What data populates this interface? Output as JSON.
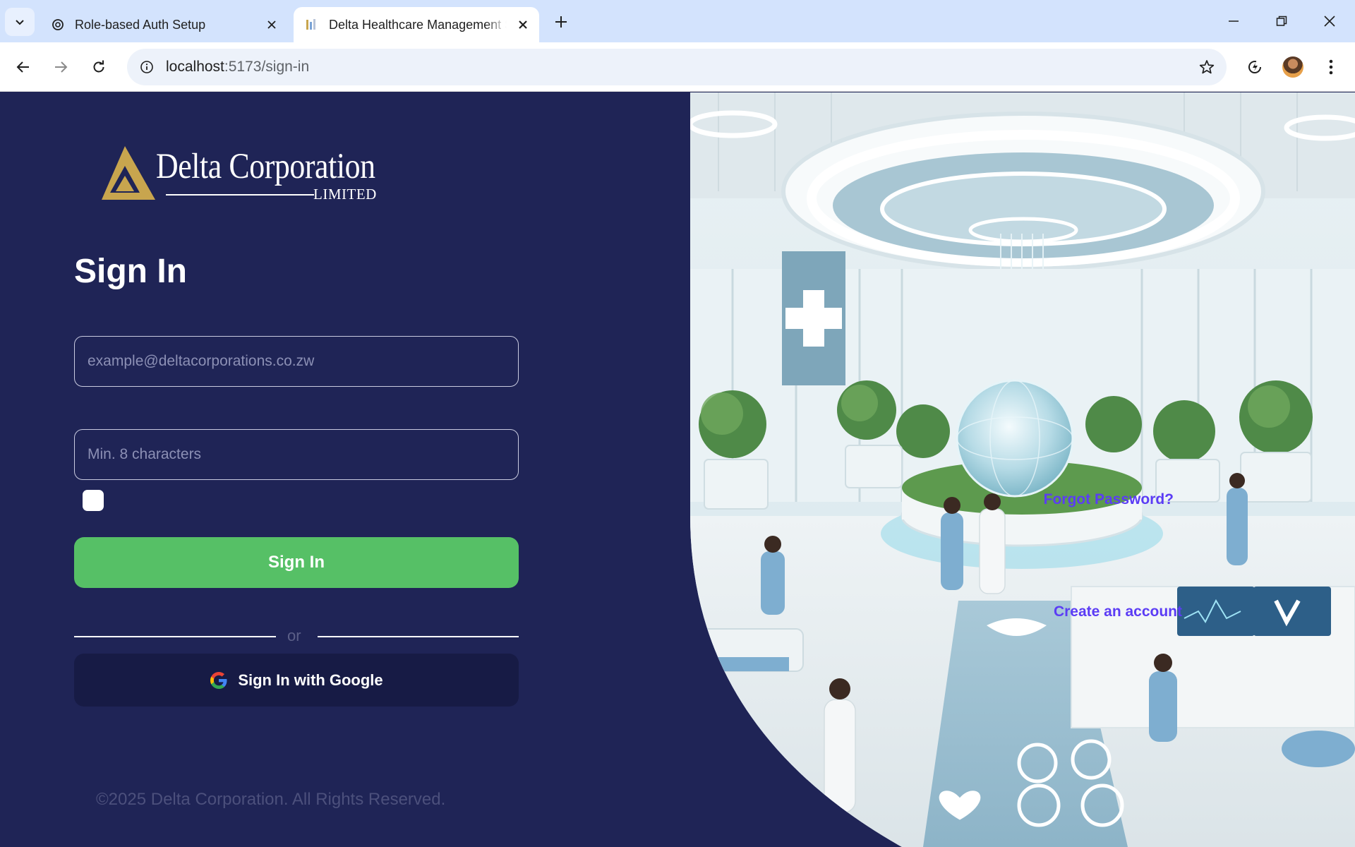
{
  "browser": {
    "tabs": [
      {
        "title": "Role-based Auth Setup",
        "favicon": "openai-icon",
        "active": false
      },
      {
        "title": "Delta Healthcare Management Syste",
        "favicon": "page-favicon",
        "active": true
      }
    ],
    "url_host": "localhost",
    "url_path": ":5173/sign-in"
  },
  "signin": {
    "heading": "Sign In",
    "email_placeholder": "example@deltacorporations.co.zw",
    "password_placeholder": "Min. 8 characters",
    "forgot_label": "Forgot Password?",
    "submit_label": "Sign In",
    "create_label": "Create an account",
    "divider_label": "or",
    "google_label": "Sign In with Google"
  },
  "logo": {
    "brand": "Delta Corporation",
    "sub": "LIMITED"
  },
  "footer": "©2025 Delta Corporation. All Rights Reserved.",
  "colors": {
    "page_bg": "#1f2456",
    "accent_link": "#5b3cf5",
    "primary_button": "#56c066",
    "google_button": "#171b45",
    "logo_gold": "#c8a54e"
  }
}
